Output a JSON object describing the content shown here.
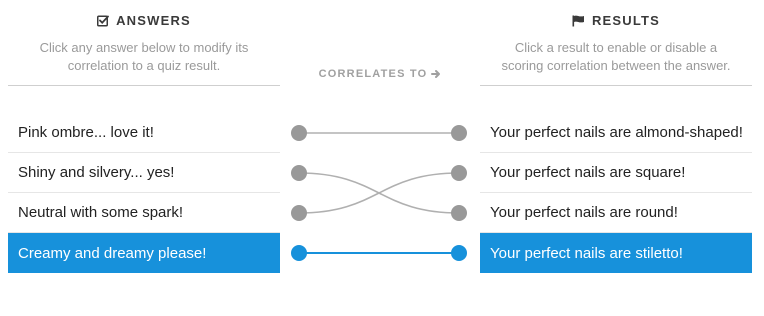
{
  "answers": {
    "title": "ANSWERS",
    "description": "Click any answer below to modify its correlation to a quiz result.",
    "items": [
      {
        "label": "Pink ombre... love it!"
      },
      {
        "label": "Shiny and silvery... yes!"
      },
      {
        "label": "Neutral with some spark!"
      },
      {
        "label": "Creamy and dreamy please!"
      }
    ],
    "selected_index": 3
  },
  "middle": {
    "label": "CORRELATES TO"
  },
  "results": {
    "title": "RESULTS",
    "description": "Click a result to enable or disable a scoring correlation between the answer.",
    "items": [
      {
        "label": "Your perfect nails are almond-shaped!"
      },
      {
        "label": "Your perfect nails are square!"
      },
      {
        "label": "Your perfect nails are round!"
      },
      {
        "label": "Your perfect nails are stiletto!"
      }
    ],
    "selected_index": 3
  },
  "correlations": [
    {
      "answer": 0,
      "result": 0
    },
    {
      "answer": 1,
      "result": 2
    },
    {
      "answer": 2,
      "result": 1
    },
    {
      "answer": 3,
      "result": 3
    }
  ],
  "colors": {
    "accent": "#1791db",
    "node_inactive": "#999999",
    "line_inactive": "#b0b0b0"
  },
  "icons": {
    "answers": "checkbox-icon",
    "results": "flag-icon",
    "middle": "arrow-right-icon"
  }
}
